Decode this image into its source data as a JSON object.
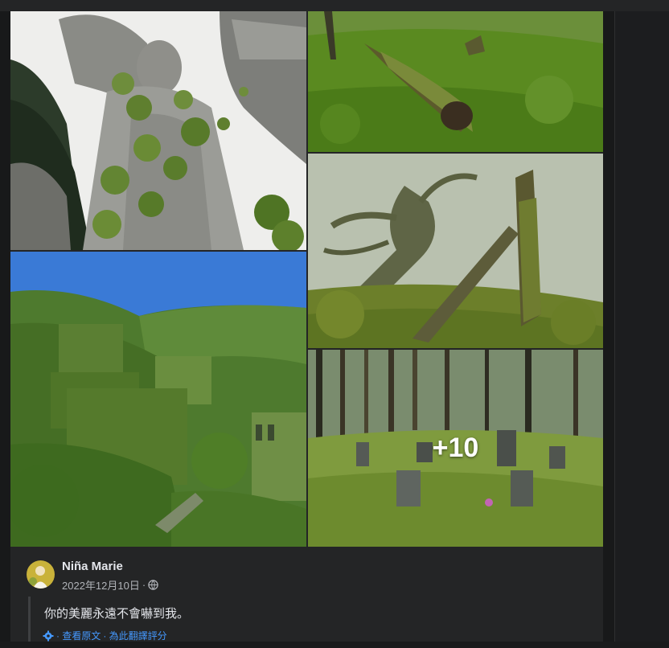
{
  "post": {
    "photos": [
      {
        "name": "angel-statue-ivy-photo"
      },
      {
        "name": "mossy-fallen-log-photo"
      },
      {
        "name": "misty-twisted-tree-photo"
      },
      {
        "name": "overgrown-village-photo"
      },
      {
        "name": "forest-standing-stones-photo",
        "overlay": "+10"
      }
    ],
    "author": {
      "name": "Niña Marie",
      "date": "2022年12月10日",
      "separator": "·",
      "privacy_icon": "globe-icon"
    },
    "text": "你的美麗永遠不會嚇到我。",
    "translation": {
      "icon": "gear-icon",
      "see_original": "· 查看原文",
      "rate": "· 為此翻譯評分"
    }
  },
  "colors": {
    "background": "#18191a",
    "card": "#242526",
    "text_primary": "#e4e6eb",
    "text_secondary": "#b0b3b8",
    "link": "#4599ff"
  }
}
